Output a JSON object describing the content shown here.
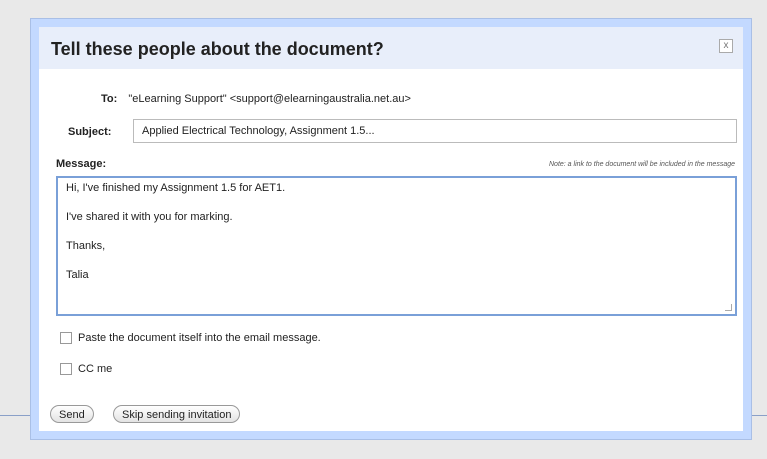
{
  "dialog": {
    "title": "Tell these people about the document?",
    "close_label": "x"
  },
  "to": {
    "label": "To:",
    "value": "\"eLearning Support\" <support@elearningaustralia.net.au>"
  },
  "subject": {
    "label": "Subject:",
    "value": "Applied Electrical Technology, Assignment 1.5..."
  },
  "message": {
    "label": "Message:",
    "note": "Note: a link to the document will be included in the message",
    "lines": [
      "Hi, I've finished my Assignment 1.5 for AET1.",
      "I've shared it with you for marking.",
      "Thanks,",
      "Talia"
    ]
  },
  "options": {
    "paste_label": "Paste the document itself into the email message.",
    "paste_checked": false,
    "cc_label": "CC me",
    "cc_checked": false
  },
  "buttons": {
    "send": "Send",
    "skip": "Skip sending invitation"
  }
}
